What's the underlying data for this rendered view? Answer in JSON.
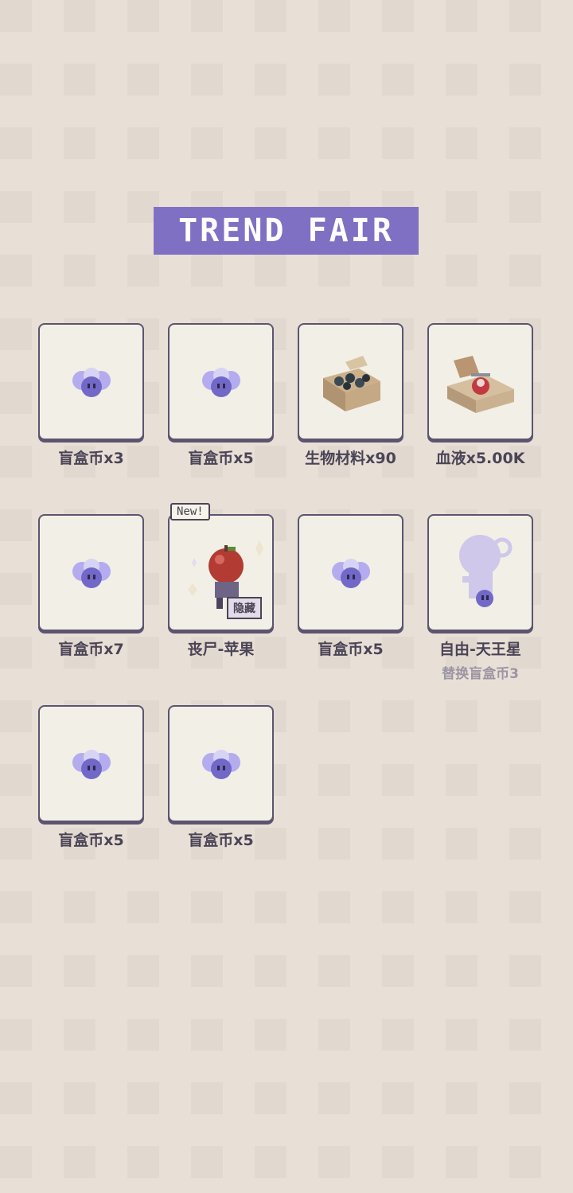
{
  "header": {
    "title": "TREND FAIR",
    "accent": "#7f70c4"
  },
  "items": [
    {
      "label": "盲盒币x3",
      "icon": "blind-box-coin-icon"
    },
    {
      "label": "盲盒币x5",
      "icon": "blind-box-coin-icon"
    },
    {
      "label": "生物材料x90",
      "icon": "bio-material-crate-icon"
    },
    {
      "label": "血液x5.00K",
      "icon": "blood-crate-icon"
    },
    {
      "label": "盲盒币x7",
      "icon": "blind-box-coin-icon"
    },
    {
      "label": "丧尸-苹果",
      "icon": "zombie-apple-figure-icon",
      "new_badge": "New!",
      "tag": "隐藏"
    },
    {
      "label": "盲盒币x5",
      "icon": "blind-box-coin-icon"
    },
    {
      "label": "自由-天王星",
      "icon": "silhouette-figure-icon",
      "sub_label": "替换盲盒币3"
    },
    {
      "label": "盲盒币x5",
      "icon": "blind-box-coin-icon"
    },
    {
      "label": "盲盒币x5",
      "icon": "blind-box-coin-icon"
    }
  ]
}
